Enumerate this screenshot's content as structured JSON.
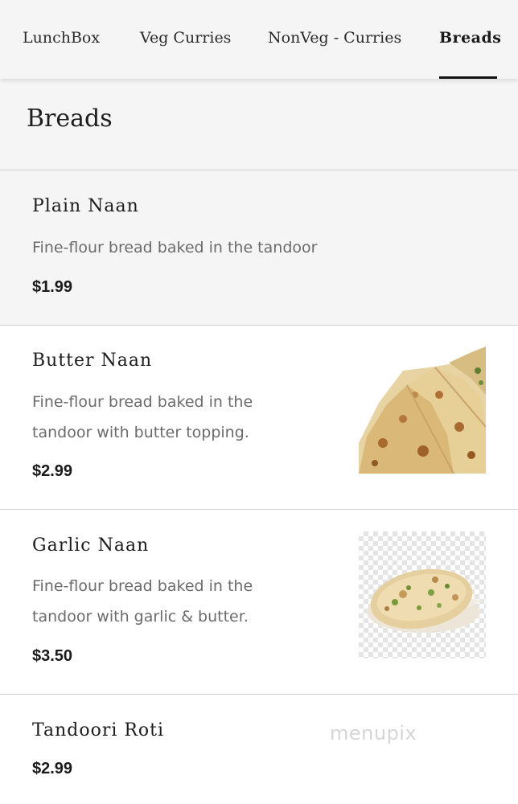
{
  "nav": {
    "tabs": [
      {
        "label": "LunchBox"
      },
      {
        "label": "Veg Curries"
      },
      {
        "label": "NonVeg - Curries"
      },
      {
        "label": "Breads",
        "active": true
      }
    ]
  },
  "section": {
    "title": "Breads"
  },
  "items": [
    {
      "name": "Plain Naan",
      "description": "Fine-flour bread baked in the tandoor",
      "price": "$1.99",
      "image": "none"
    },
    {
      "name": "Butter Naan",
      "description_lines": [
        "Fine-flour bread baked in the",
        "tandoor with butter topping."
      ],
      "price": "$2.99",
      "image": "butter-naan-photo"
    },
    {
      "name": "Garlic Naan",
      "description_lines": [
        "Fine-flour bread baked in the",
        "tandoor with garlic & butter."
      ],
      "price": "$3.50",
      "image": "garlic-naan-photo"
    },
    {
      "name": "Tandoori Roti",
      "price": "$2.99",
      "image": "none"
    }
  ],
  "watermark": "menupix",
  "colors": {
    "background": "#ffffff",
    "nav_background": "#f5f5f5",
    "accent": "#111111",
    "description_text": "#6b6b6b"
  }
}
